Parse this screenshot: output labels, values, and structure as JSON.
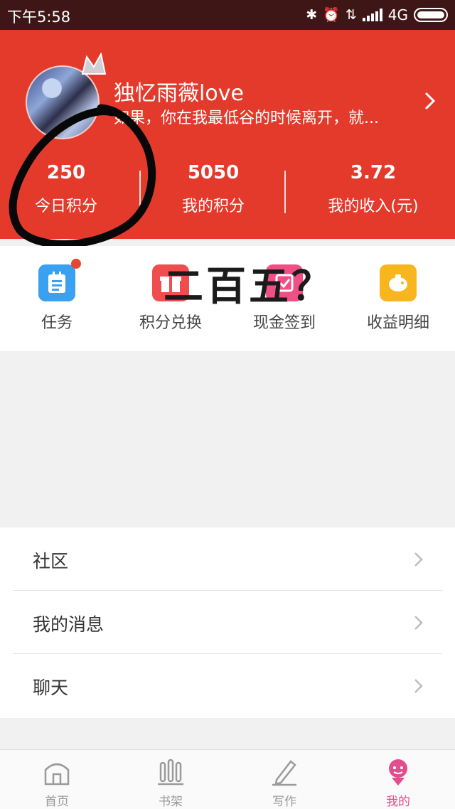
{
  "status_bar": {
    "time": "下午5:58",
    "network": "4G",
    "icons": [
      "bluetooth-icon",
      "alarm-icon",
      "data-icon",
      "signal-icon",
      "battery-icon"
    ]
  },
  "profile": {
    "username": "独忆雨薇love",
    "bio": "如果，你在我最低谷的时候离开，就..."
  },
  "stats": [
    {
      "value": "250",
      "label": "今日积分"
    },
    {
      "value": "5050",
      "label": "我的积分"
    },
    {
      "value": "3.72",
      "label": "我的收入(元)"
    }
  ],
  "quick_menu": [
    {
      "label": "任务",
      "icon": "task-icon",
      "color": "#3aa0f0"
    },
    {
      "label": "积分兑换",
      "icon": "gift-icon",
      "color": "#ee4e4e"
    },
    {
      "label": "现金签到",
      "icon": "checkin-icon",
      "color": "#f04f86"
    },
    {
      "label": "收益明细",
      "icon": "piggy-bank-icon",
      "color": "#f7b51e"
    }
  ],
  "annotation_text": "二百五？",
  "list": [
    {
      "label": "社区"
    },
    {
      "label": "我的消息"
    },
    {
      "label": "聊天"
    }
  ],
  "tabs": [
    {
      "label": "首页",
      "icon": "home-icon"
    },
    {
      "label": "书架",
      "icon": "bookshelf-icon"
    },
    {
      "label": "写作",
      "icon": "pencil-icon"
    },
    {
      "label": "我的",
      "icon": "profile-icon"
    }
  ],
  "colors": {
    "header_red": "#e33a2c",
    "status_bar": "#3f1616",
    "active_tab": "#e34d8e"
  }
}
